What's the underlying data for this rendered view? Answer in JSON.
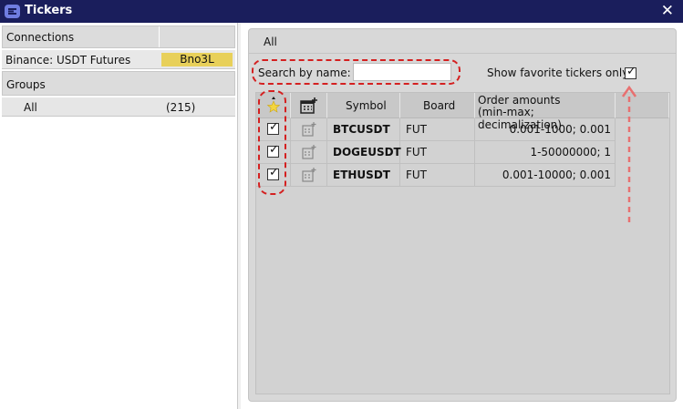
{
  "window": {
    "title": "Tickers",
    "close_glyph": "✕",
    "app_icon": "app-logo-icon"
  },
  "left": {
    "connections_header": "Connections",
    "connection": {
      "name": "Binance: USDT Futures",
      "badge": "Bno3L",
      "badge_color": "#e8d05a"
    },
    "groups_header": "Groups",
    "group": {
      "name": "All",
      "count": "(215)"
    }
  },
  "right": {
    "tab_label": "All",
    "search_label": "Search by name:",
    "search_value": "",
    "favorites_label": "Show favorite tickers only",
    "favorites_checked": true,
    "columns": [
      "Symbol",
      "Board",
      "Order amounts",
      "(min-max; decimalization)"
    ],
    "rows": [
      {
        "favorite": true,
        "symbol": "BTCUSDT",
        "board": "FUT",
        "amounts": "0.001-1000; 0.001"
      },
      {
        "favorite": true,
        "symbol": "DOGEUSDT",
        "board": "FUT",
        "amounts": "1-50000000; 1"
      },
      {
        "favorite": true,
        "symbol": "ETHUSDT",
        "board": "FUT",
        "amounts": "0.001-10000; 0.001"
      }
    ]
  },
  "icons": {
    "favorite_column": "star-icon",
    "add_ticker": "calendar-plus-icon",
    "check": "checkmark-icon"
  },
  "colors": {
    "titlebar": "#1a1e5c",
    "highlight": "#d42020",
    "arrow": "#e87070"
  }
}
